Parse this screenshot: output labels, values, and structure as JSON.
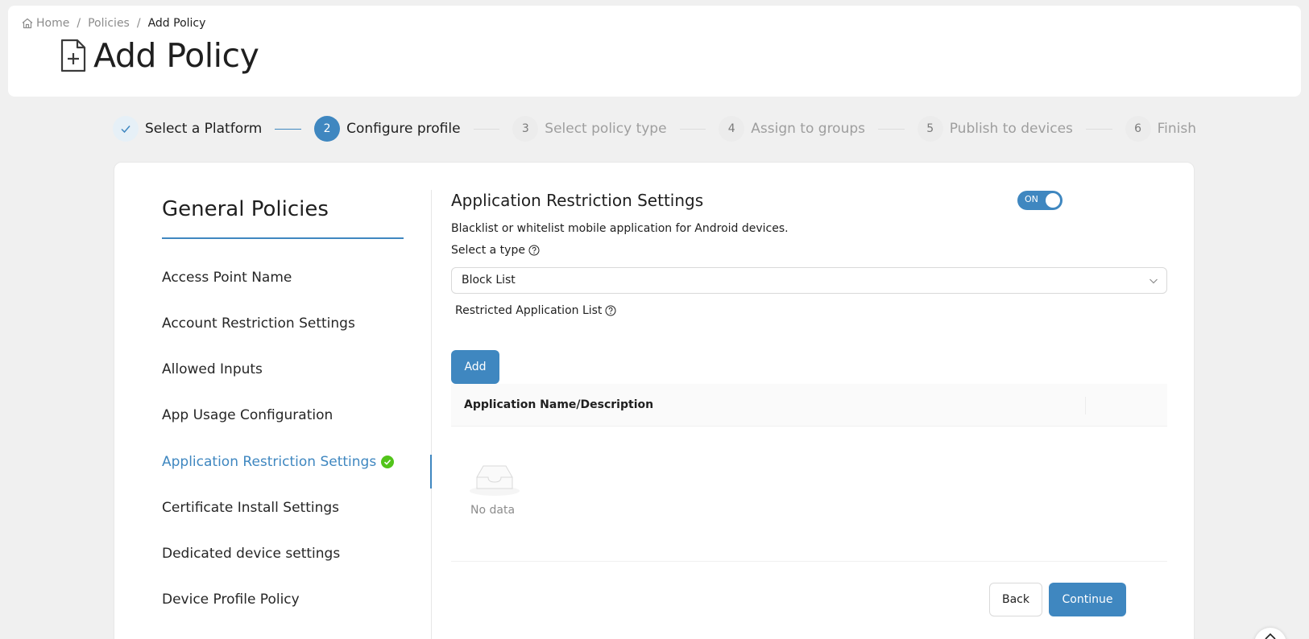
{
  "breadcrumb": {
    "home": "Home",
    "policies": "Policies",
    "current": "Add Policy"
  },
  "page": {
    "title": "Add Policy"
  },
  "steps": [
    {
      "number": "1",
      "label": "Select a Platform",
      "status": "done"
    },
    {
      "number": "2",
      "label": "Configure profile",
      "status": "active"
    },
    {
      "number": "3",
      "label": "Select policy type",
      "status": "wait"
    },
    {
      "number": "4",
      "label": "Assign to groups",
      "status": "wait"
    },
    {
      "number": "5",
      "label": "Publish to devices",
      "status": "wait"
    },
    {
      "number": "6",
      "label": "Finish",
      "status": "wait"
    }
  ],
  "sidebar": {
    "title": "General Policies",
    "items": [
      {
        "label": "Access Point Name"
      },
      {
        "label": "Account Restriction Settings"
      },
      {
        "label": "Allowed Inputs"
      },
      {
        "label": "App Usage Configuration"
      },
      {
        "label": "Application Restriction Settings"
      },
      {
        "label": "Certificate Install Settings"
      },
      {
        "label": "Dedicated device settings"
      },
      {
        "label": "Device Profile Policy"
      }
    ]
  },
  "content": {
    "title": "Application Restriction Settings",
    "description": "Blacklist or whitelist mobile application for Android devices.",
    "toggle_label": "ON",
    "type_label": "Select a type",
    "type_value": "Block List",
    "list_label": "Restricted Application List",
    "add_label": "Add",
    "table_header": "Application Name/Description",
    "empty_text": "No data",
    "back_label": "Back",
    "continue_label": "Continue"
  },
  "colors": {
    "primary": "#3f87c0",
    "success": "#52c41a",
    "background": "#f0f0f0"
  }
}
